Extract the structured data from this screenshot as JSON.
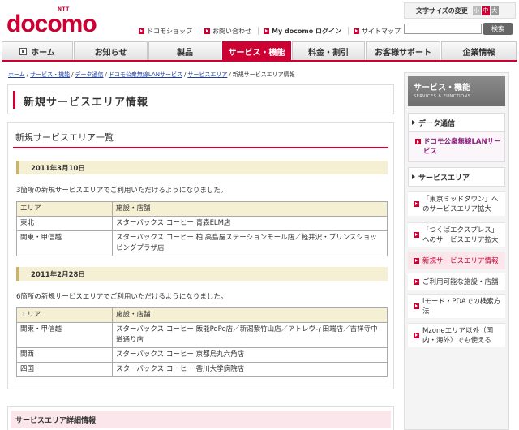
{
  "header": {
    "logo_ntt": "NTT",
    "logo_name": "docomo",
    "links": [
      {
        "label": "ドコモショップ"
      },
      {
        "label": "お問い合わせ"
      },
      {
        "label": "My docomo ログイン"
      },
      {
        "label": "サイトマップ"
      }
    ],
    "font_size": {
      "label": "文字サイズの変更",
      "small": "小",
      "medium": "中",
      "large": "大"
    },
    "search": {
      "placeholder": "",
      "button": "検索"
    }
  },
  "nav": {
    "home": "ホーム",
    "news": "お知らせ",
    "products": "製品",
    "services": "サービス・機能",
    "pricing": "料金・割引",
    "support": "お客様サポート",
    "corporate": "企業情報"
  },
  "breadcrumb": {
    "items": [
      "ホーム",
      "サービス・機能",
      "データ通信",
      "ドコモ公衆無線LANサービス",
      "サービスエリア"
    ],
    "current": "新規サービスエリア情報"
  },
  "page": {
    "title": "新規サービスエリア情報",
    "section_title": "新規サービスエリア一覧",
    "table_headers": {
      "area": "エリア",
      "facility": "施設・店舗"
    },
    "updates": [
      {
        "date": "2011年3月10日",
        "note": "3箇所の新規サービスエリアでご利用いただけるようになりました。",
        "rows": [
          {
            "area": "東北",
            "facility": "スターバックス コーヒー 青森ELM店"
          },
          {
            "area": "関東・甲信越",
            "facility": "スターバックス コーヒー 柏 高島屋ステーションモール店／軽井沢・プリンスショッピングプラザ店"
          }
        ]
      },
      {
        "date": "2011年2月28日",
        "note": "6箇所の新規サービスエリアでご利用いただけるようになりました。",
        "rows": [
          {
            "area": "関東・甲信越",
            "facility": "スターバックス コーヒー 飯能PePe店／新潟紫竹山店／アトレヴィ田端店／吉祥寺中道通り店"
          },
          {
            "area": "関西",
            "facility": "スターバックス コーヒー 京都烏丸六角店"
          },
          {
            "area": "四国",
            "facility": "スターバックス コーヒー 香川大学病院店"
          }
        ]
      }
    ],
    "detail_title": "サービスエリア詳細情報"
  },
  "sidebar": {
    "heading": "サービス・機能",
    "heading_en": "SERVICES & FUNCTIONS",
    "data_comm": "データ通信",
    "wlan": "ドコモ公衆無線LANサービス",
    "area": "サービスエリア",
    "links": [
      "「東京ミッドタウン」へのサービスエリア拡大",
      "「つくばエクスプレス」へのサービスエリア拡大",
      "新規サービスエリア情報",
      "ご利用可能な施設・店舗",
      "iモード・PDAでの検索方法",
      "Mzoneエリア以外（国内・海外）でも使える"
    ]
  }
}
